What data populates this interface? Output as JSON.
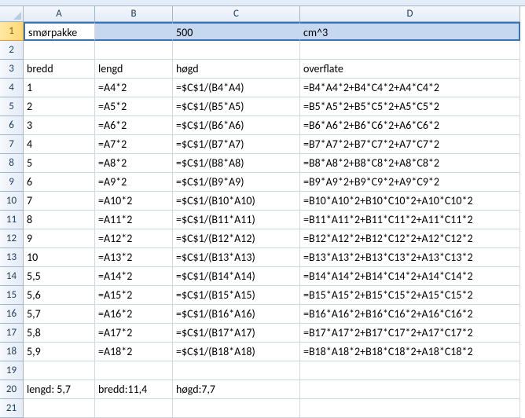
{
  "columns": [
    "A",
    "B",
    "C",
    "D"
  ],
  "row_numbers": [
    1,
    2,
    3,
    4,
    5,
    6,
    7,
    8,
    9,
    10,
    11,
    12,
    13,
    14,
    15,
    16,
    17,
    18,
    19,
    20,
    21
  ],
  "selected_row": 1,
  "rows": [
    {
      "A": "smørpakke",
      "B": "",
      "C": "500",
      "D": "cm^3"
    },
    {
      "A": "",
      "B": "",
      "C": "",
      "D": ""
    },
    {
      "A": "bredd",
      "B": "lengd",
      "C": "høgd",
      "D": "overflate"
    },
    {
      "A": "1",
      "B": "=A4*2",
      "C": "=$C$1/(B4*A4)",
      "D": "=B4*A4*2+B4*C4*2+A4*C4*2"
    },
    {
      "A": "2",
      "B": "=A5*2",
      "C": "=$C$1/(B5*A5)",
      "D": "=B5*A5*2+B5*C5*2+A5*C5*2"
    },
    {
      "A": "3",
      "B": "=A6*2",
      "C": "=$C$1/(B6*A6)",
      "D": "=B6*A6*2+B6*C6*2+A6*C6*2"
    },
    {
      "A": "4",
      "B": "=A7*2",
      "C": "=$C$1/(B7*A7)",
      "D": "=B7*A7*2+B7*C7*2+A7*C7*2"
    },
    {
      "A": "5",
      "B": "=A8*2",
      "C": "=$C$1/(B8*A8)",
      "D": "=B8*A8*2+B8*C8*2+A8*C8*2"
    },
    {
      "A": "6",
      "B": "=A9*2",
      "C": "=$C$1/(B9*A9)",
      "D": "=B9*A9*2+B9*C9*2+A9*C9*2"
    },
    {
      "A": "7",
      "B": "=A10*2",
      "C": "=$C$1/(B10*A10)",
      "D": "=B10*A10*2+B10*C10*2+A10*C10*2"
    },
    {
      "A": "8",
      "B": "=A11*2",
      "C": "=$C$1/(B11*A11)",
      "D": "=B11*A11*2+B11*C11*2+A11*C11*2"
    },
    {
      "A": "9",
      "B": "=A12*2",
      "C": "=$C$1/(B12*A12)",
      "D": "=B12*A12*2+B12*C12*2+A12*C12*2"
    },
    {
      "A": "10",
      "B": "=A13*2",
      "C": "=$C$1/(B13*A13)",
      "D": "=B13*A13*2+B13*C13*2+A13*C13*2"
    },
    {
      "A": "5,5",
      "B": "=A14*2",
      "C": "=$C$1/(B14*A14)",
      "D": "=B14*A14*2+B14*C14*2+A14*C14*2"
    },
    {
      "A": "5,6",
      "B": "=A15*2",
      "C": "=$C$1/(B15*A15)",
      "D": "=B15*A15*2+B15*C15*2+A15*C15*2"
    },
    {
      "A": "5,7",
      "B": "=A16*2",
      "C": "=$C$1/(B16*A16)",
      "D": "=B16*A16*2+B16*C16*2+A16*C16*2"
    },
    {
      "A": "5,8",
      "B": "=A17*2",
      "C": "=$C$1/(B17*A17)",
      "D": "=B17*A17*2+B17*C17*2+A17*C17*2"
    },
    {
      "A": "5,9",
      "B": "=A18*2",
      "C": "=$C$1/(B18*A18)",
      "D": "=B18*A18*2+B18*C18*2+A18*C18*2"
    },
    {
      "A": "",
      "B": "",
      "C": "",
      "D": ""
    },
    {
      "A": "lengd: 5,7",
      "B": "bredd:11,4",
      "C": "høgd:7,7",
      "D": ""
    },
    {
      "A": "",
      "B": "",
      "C": "",
      "D": ""
    }
  ]
}
